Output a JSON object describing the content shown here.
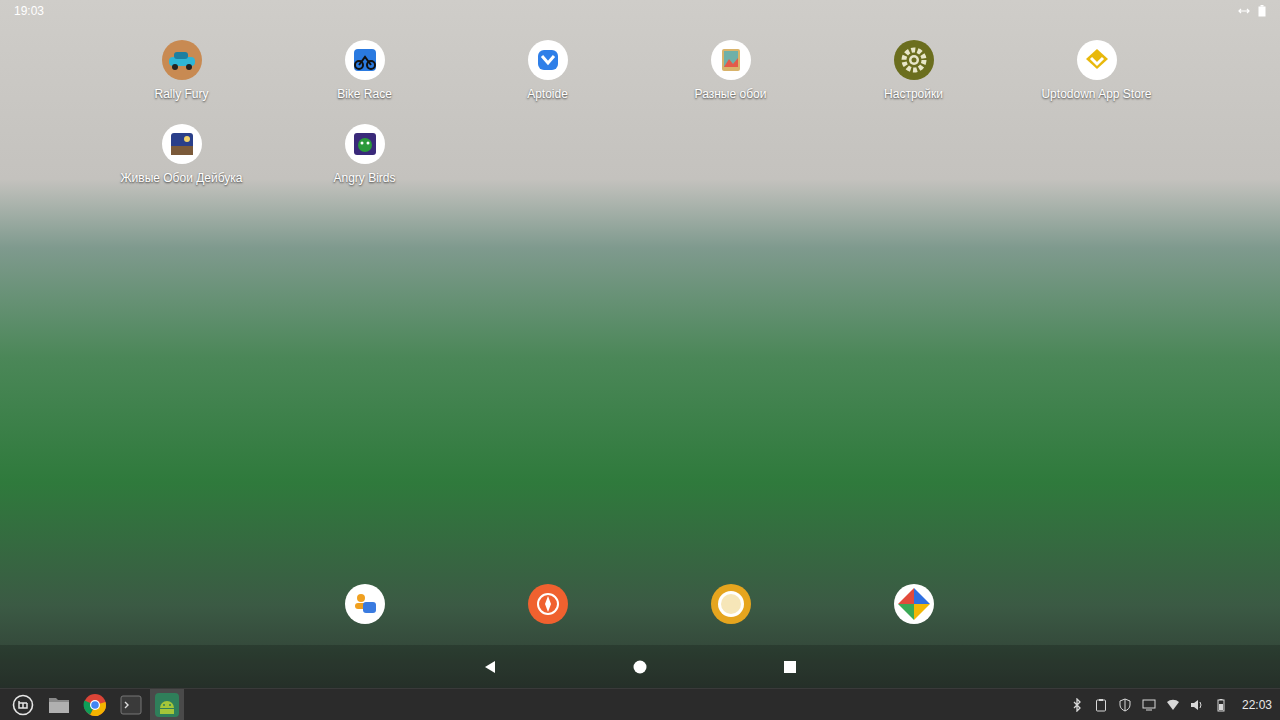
{
  "android": {
    "status_bar": {
      "time": "19:03"
    },
    "apps": [
      {
        "label": "Rally Fury",
        "kind": "car"
      },
      {
        "label": "Bike Race",
        "kind": "bike"
      },
      {
        "label": "Aptoide",
        "kind": "aptoide"
      },
      {
        "label": "Разные обои",
        "kind": "wallpaper"
      },
      {
        "label": "Настройки",
        "kind": "settings"
      },
      {
        "label": "Uptodown App Store",
        "kind": "uptodown"
      },
      {
        "label": "Живые Обои Дейбука",
        "kind": "live"
      },
      {
        "label": "Angry Birds",
        "kind": "birds"
      }
    ],
    "dock": [
      {
        "kind": "people"
      },
      {
        "kind": "compass"
      },
      {
        "kind": "camera"
      },
      {
        "kind": "gallery"
      }
    ],
    "nav_bar": [
      {
        "kind": "back"
      },
      {
        "kind": "home"
      },
      {
        "kind": "recents"
      }
    ]
  },
  "taskbar": {
    "items": [
      {
        "kind": "menu",
        "active": false
      },
      {
        "kind": "files",
        "active": false
      },
      {
        "kind": "browser",
        "active": false
      },
      {
        "kind": "terminal",
        "active": false
      },
      {
        "kind": "android",
        "active": true
      }
    ],
    "tray": [
      {
        "kind": "bluetooth"
      },
      {
        "kind": "clipboard"
      },
      {
        "kind": "shield"
      },
      {
        "kind": "display"
      },
      {
        "kind": "wifi"
      },
      {
        "kind": "volume"
      },
      {
        "kind": "battery"
      }
    ],
    "clock": "22:03"
  }
}
